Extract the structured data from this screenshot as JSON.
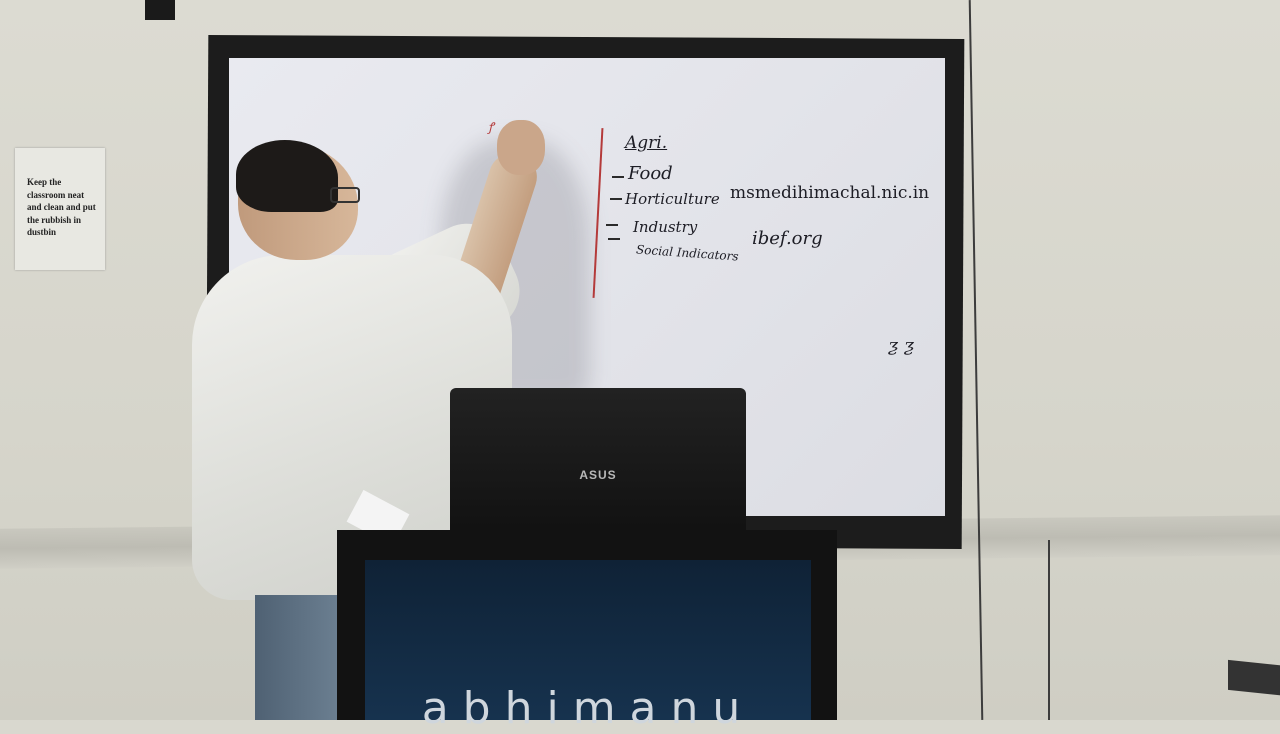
{
  "notice": {
    "text": "Keep the classroom neat and clean and put the rubbish in dustbin"
  },
  "whiteboard": {
    "heading": "Agri.",
    "items": [
      "Food",
      "Horticulture",
      "Industry",
      "Social Indicators"
    ],
    "url_1": "msmedihimachal.nic.in",
    "url_2": "ibef.org",
    "doodle": "ƺ ƺ"
  },
  "laptop": {
    "brand": "ASUS"
  },
  "podium": {
    "text": "abhimanu"
  }
}
